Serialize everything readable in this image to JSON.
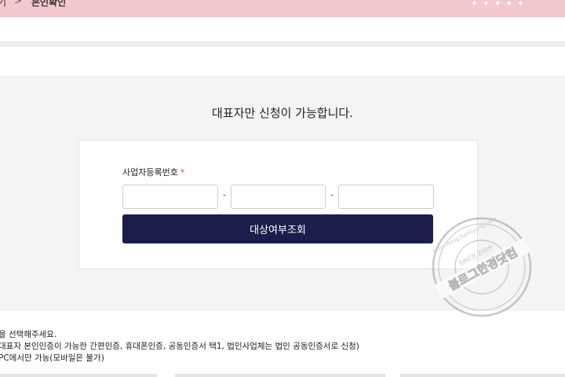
{
  "breadcrumb": {
    "prev": "기",
    "separator": ">",
    "current": "본인확인"
  },
  "main": {
    "notice_title": "대표자만 신청이 가능합니다.",
    "form": {
      "brn_label": "사업자등록번호",
      "required_mark": "*",
      "brn_part1": "",
      "brn_part2": "",
      "brn_part3": "",
      "dash1": "-",
      "dash2": "-",
      "submit_label": "대상여부조회"
    }
  },
  "notes": [
    "을 선택해주세요.",
    "대표자 본인인증이 가능한 간편인증, 휴대폰인증, 공동인증서 택1, 법인사업체는 법인 공동인증서로 신청)",
    "PC에서만 가능(모바일은 불가)"
  ],
  "watermark": {
    "main": "블로그한경닷컴",
    "url": "http://blog.hankyung.com",
    "since": "SINCE 2009"
  },
  "colors": {
    "top_band": "#f3c8cf",
    "section_bg": "#f3f4f6",
    "button_bg": "#1b1e4b",
    "required": "#e53e3e"
  }
}
